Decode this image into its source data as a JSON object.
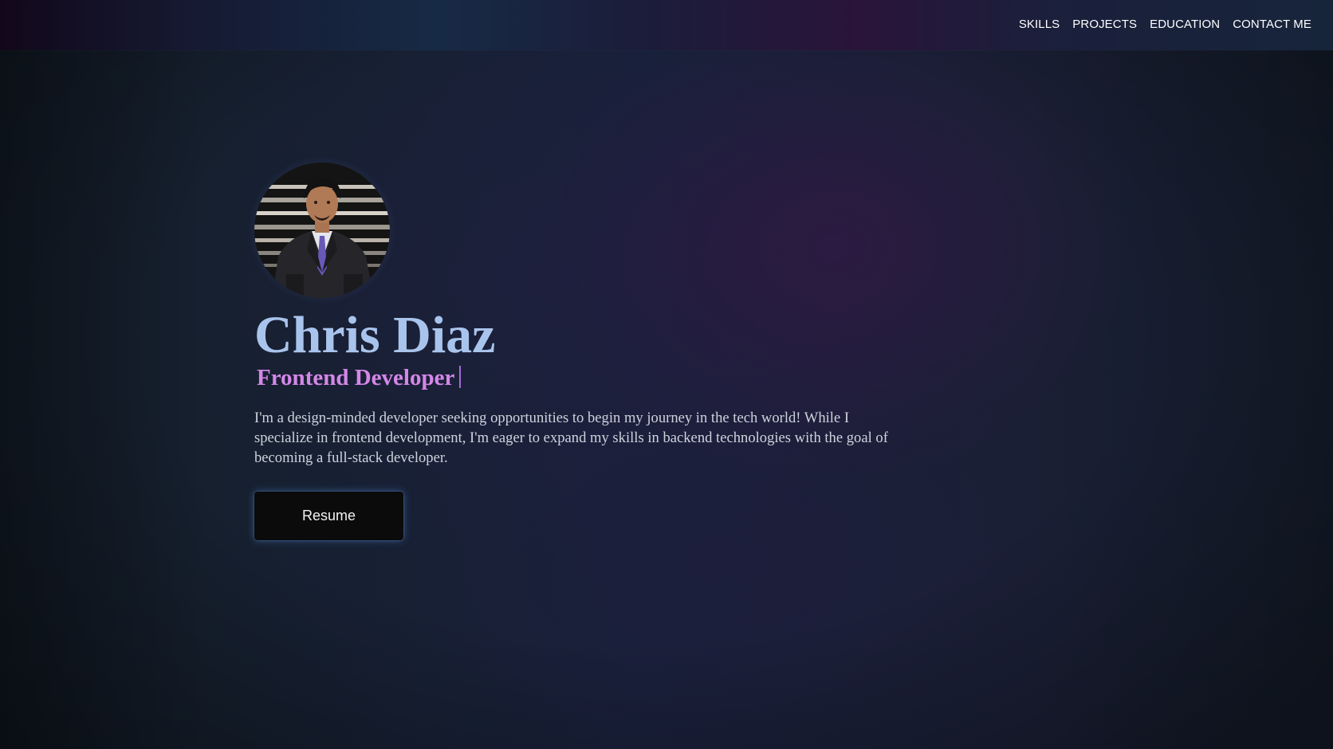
{
  "nav": {
    "links": [
      "SKILLS",
      "PROJECTS",
      "EDUCATION",
      "CONTACT ME"
    ]
  },
  "hero": {
    "name": "Chris Diaz",
    "role": "Frontend Developer",
    "bio": "I'm a design-minded developer seeking opportunities to begin my journey in the tech world! While I specialize in frontend development, I'm eager to expand my skills in backend technologies with the goal of becoming a full-stack developer.",
    "resume_label": "Resume"
  },
  "colors": {
    "name": "#a9c4ec",
    "role": "#d487e8",
    "button_bg": "#0b0b0c",
    "button_glow": "#5a96e6",
    "background": "#16202f"
  }
}
